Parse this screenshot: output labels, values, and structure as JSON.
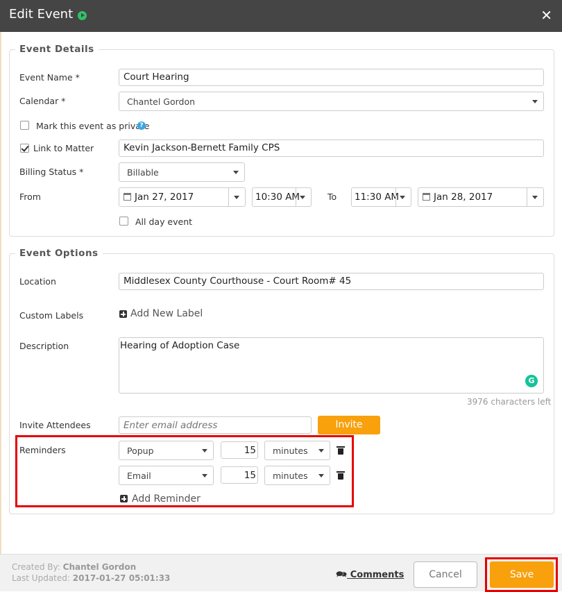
{
  "window": {
    "title": "Edit Event",
    "close_glyph": "✕"
  },
  "icons": {
    "close": "close-icon",
    "status": "play-circle-icon",
    "help": "question-circle-icon",
    "add": "plus-square-icon",
    "delete": "trash-icon",
    "calendar": "calendar-icon",
    "chat": "chat-bubbles-icon",
    "grammarly": "grammarly-icon"
  },
  "colors": {
    "titlebar": "#454545",
    "accent": "#f8a10d",
    "highlight": "#e60000",
    "status": "#2ec26a"
  },
  "details": {
    "legend": "Event Details",
    "event_name_label": "Event Name *",
    "event_name_value": "Court Hearing",
    "calendar_label": "Calendar *",
    "calendar_value": "Chantel Gordon",
    "private_label": "Mark this event as private",
    "private_checked": false,
    "link_label": "Link to Matter",
    "link_checked": true,
    "matter_value": "Kevin Jackson-Bernett Family CPS",
    "billing_label": "Billing Status *",
    "billing_value": "Billable",
    "from_label": "From",
    "from_date": "Jan 27, 2017",
    "from_time": "10:30 AM",
    "to_label": "To",
    "to_time": "11:30 AM",
    "to_date": "Jan 28, 2017",
    "allday_label": "All day event",
    "allday_checked": false
  },
  "options": {
    "legend": "Event Options",
    "location_label": "Location",
    "location_value": "Middlesex County Courthouse - Court Room# 45",
    "labels_label": "Custom Labels",
    "add_label": "Add New Label",
    "description_label": "Description",
    "description_value": "Hearing of Adoption Case",
    "chars_left": "3976 characters left",
    "attendees_label": "Invite Attendees",
    "attendees_placeholder": "Enter email address",
    "invite_button": "Invite",
    "reminders_label": "Reminders",
    "reminders": [
      {
        "type": "Popup",
        "amount": "15",
        "unit": "minutes"
      },
      {
        "type": "Email",
        "amount": "15",
        "unit": "minutes"
      }
    ],
    "add_reminder": "Add Reminder"
  },
  "footer": {
    "created_label": "Created By:",
    "created_by": "Chantel Gordon",
    "updated_label": "Last Updated:",
    "updated_at": "2017-01-27 05:01:33",
    "comments": "Comments",
    "cancel": "Cancel",
    "save": "Save"
  }
}
